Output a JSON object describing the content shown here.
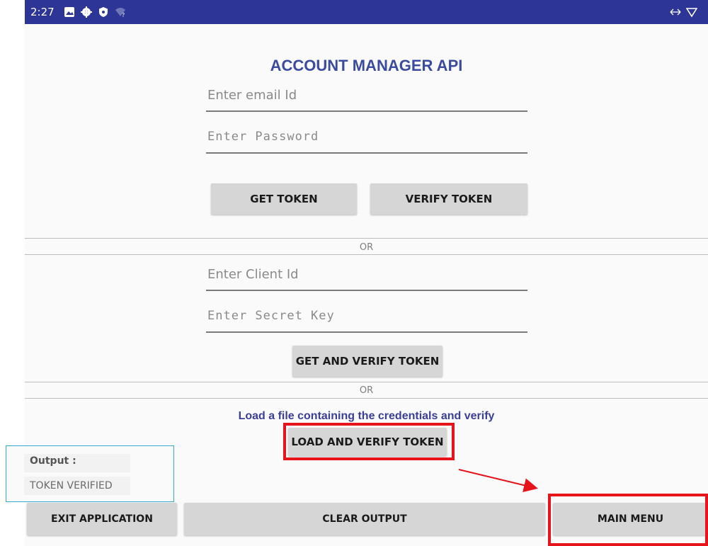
{
  "status_bar": {
    "time": "2:27"
  },
  "title": "ACCOUNT MANAGER API",
  "credentials": {
    "email_placeholder": "Enter email Id",
    "password_placeholder": "Enter Password",
    "get_token_label": "GET TOKEN",
    "verify_token_label": "VERIFY TOKEN"
  },
  "or_separator_1": "OR",
  "client": {
    "client_id_placeholder": "Enter Client Id",
    "secret_key_placeholder": "Enter Secret Key",
    "get_and_verify_label": "GET AND VERIFY TOKEN"
  },
  "or_separator_2": "OR",
  "file": {
    "info_text": "Load a file containing the credentials and verify",
    "load_and_verify_label": "LOAD AND VERIFY TOKEN"
  },
  "output": {
    "label": "Output :",
    "value": "TOKEN VERIFIED"
  },
  "bottom_bar": {
    "exit_label": "EXIT APPLICATION",
    "clear_label": "CLEAR OUTPUT",
    "main_menu_label": "MAIN MENU"
  },
  "colors": {
    "status_bar": "#2d3596",
    "title": "#3b4ba0",
    "highlight": "#e8141c",
    "output_border": "#36a9d6"
  }
}
